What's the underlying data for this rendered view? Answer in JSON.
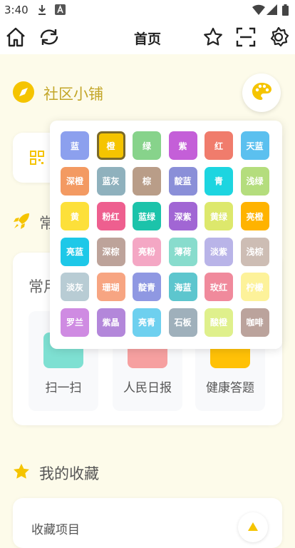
{
  "status_bar": {
    "time": "3:40"
  },
  "header": {
    "title": "首页"
  },
  "section_shop": {
    "title": "社区小铺"
  },
  "section_common": {
    "title_partial": "常",
    "card_title_partial": "常用"
  },
  "tiles": [
    {
      "label": "扫一扫",
      "color": "#7ee0d2"
    },
    {
      "label": "人民日报",
      "color": "#f6a0a0"
    },
    {
      "label": "健康答题",
      "color": "#ffc107"
    }
  ],
  "section_favorites": {
    "title": "我的收藏",
    "card_text_partial": "收藏项目"
  },
  "theme_colors": [
    {
      "name": "蓝",
      "color": "#8ca0ee"
    },
    {
      "name": "橙",
      "color": "#f5c400",
      "selected": true
    },
    {
      "name": "绿",
      "color": "#87d38b"
    },
    {
      "name": "紫",
      "color": "#c45fd8"
    },
    {
      "name": "红",
      "color": "#f07c6c"
    },
    {
      "name": "天蓝",
      "color": "#5bc0ef"
    },
    {
      "name": "深橙",
      "color": "#f39a62"
    },
    {
      "name": "蓝灰",
      "color": "#8fb1bd"
    },
    {
      "name": "棕",
      "color": "#b99d88"
    },
    {
      "name": "靛蓝",
      "color": "#8a8fd8"
    },
    {
      "name": "青",
      "color": "#1dd5e0"
    },
    {
      "name": "浅绿",
      "color": "#b4dd7d"
    },
    {
      "name": "黄",
      "color": "#fde03a"
    },
    {
      "name": "粉红",
      "color": "#ee5f8f"
    },
    {
      "name": "蓝绿",
      "color": "#1cc3aa"
    },
    {
      "name": "深紫",
      "color": "#a166d4"
    },
    {
      "name": "黄绿",
      "color": "#dde86c"
    },
    {
      "name": "亮橙",
      "color": "#ffb300"
    },
    {
      "name": "亮蓝",
      "color": "#1ec8e8"
    },
    {
      "name": "深棕",
      "color": "#bda39a"
    },
    {
      "name": "亮粉",
      "color": "#f4a7c4"
    },
    {
      "name": "薄荷",
      "color": "#88dccd"
    },
    {
      "name": "淡紫",
      "color": "#b9b4e8"
    },
    {
      "name": "浅棕",
      "color": "#cdbdb4"
    },
    {
      "name": "淡灰",
      "color": "#b8ccd4"
    },
    {
      "name": "珊瑚",
      "color": "#f7a582"
    },
    {
      "name": "靛青",
      "color": "#8f98e2"
    },
    {
      "name": "海蓝",
      "color": "#5dc6ce"
    },
    {
      "name": "玫红",
      "color": "#f08a9c"
    },
    {
      "name": "柠檬",
      "color": "#fdf29a"
    },
    {
      "name": "罗兰",
      "color": "#cf8be2"
    },
    {
      "name": "紫晶",
      "color": "#b387da"
    },
    {
      "name": "亮青",
      "color": "#6ed0ef"
    },
    {
      "name": "石板",
      "color": "#9fb0bb"
    },
    {
      "name": "酸橙",
      "color": "#dff08c"
    },
    {
      "name": "咖啡",
      "color": "#bba39c"
    }
  ]
}
